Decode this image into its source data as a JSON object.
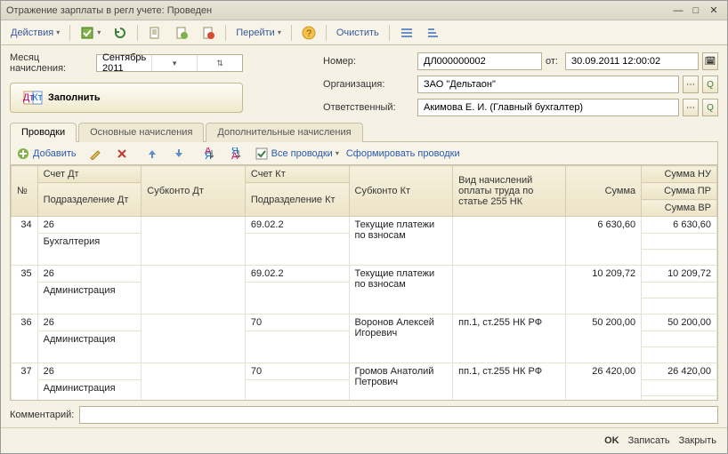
{
  "window": {
    "title": "Отражение зарплаты в регл учете: Проведен"
  },
  "actions_menu": "Действия",
  "goto_menu": "Перейти",
  "clear_btn": "Очистить",
  "period": {
    "label": "Месяц начисления:",
    "value": "Сентябрь 2011"
  },
  "header": {
    "number_label": "Номер:",
    "number_value": "ДЛ000000002",
    "from_label": "от:",
    "date_value": "30.09.2011 12:00:02",
    "org_label": "Организация:",
    "org_value": "ЗАО \"Дельтаон\"",
    "resp_label": "Ответственный:",
    "resp_value": "Акимова Е. И. (Главный бухгалтер)"
  },
  "fill_label": "Заполнить",
  "tabs": [
    "Проводки",
    "Основные начисления",
    "Дополнительные начисления"
  ],
  "subtoolbar": {
    "add": "Добавить",
    "all": "Все проводки",
    "gen": "Сформировать проводки"
  },
  "columns": {
    "no": "№",
    "acct_dt": "Счет Дт",
    "subk_dt": "Субконто Дт",
    "acct_kt": "Счет Кт",
    "subk_kt": "Субконто Кт",
    "kind": "Вид начислений оплаты труда по статье 255 НК",
    "sum": "Сумма",
    "sum_nu": "Сумма НУ",
    "dept_dt": "Подразделение Дт",
    "dept_kt": "Подразделение Кт",
    "sum_pr": "Сумма ПР",
    "sum_vr": "Сумма ВР"
  },
  "rows": [
    {
      "no": "34",
      "acct_dt": "26",
      "dept_dt": "Бухгалтерия",
      "subk_dt": "",
      "acct_kt": "69.02.2",
      "dept_kt": "",
      "subk_kt": "Текущие платежи по взносам",
      "kind": "",
      "sum": "6 630,60",
      "sum_nu": "6 630,60"
    },
    {
      "no": "35",
      "acct_dt": "26",
      "dept_dt": "Администрация",
      "subk_dt": "",
      "acct_kt": "69.02.2",
      "dept_kt": "",
      "subk_kt": "Текущие платежи по взносам",
      "kind": "",
      "sum": "10 209,72",
      "sum_nu": "10 209,72"
    },
    {
      "no": "36",
      "acct_dt": "26",
      "dept_dt": "Администрация",
      "subk_dt": "",
      "acct_kt": "70",
      "dept_kt": "",
      "subk_kt": "Воронов Алексей Игоревич",
      "kind": "пп.1, ст.255 НК РФ",
      "sum": "50 200,00",
      "sum_nu": "50 200,00"
    },
    {
      "no": "37",
      "acct_dt": "26",
      "dept_dt": "Администрация",
      "subk_dt": "",
      "acct_kt": "70",
      "dept_kt": "",
      "subk_kt": "Громов Анатолий Петрович",
      "kind": "пп.1, ст.255 НК РФ",
      "sum": "26 420,00",
      "sum_nu": "26 420,00"
    }
  ],
  "comment_label": "Комментарий:",
  "buttons": {
    "ok": "OK",
    "save": "Записать",
    "close": "Закрыть"
  }
}
